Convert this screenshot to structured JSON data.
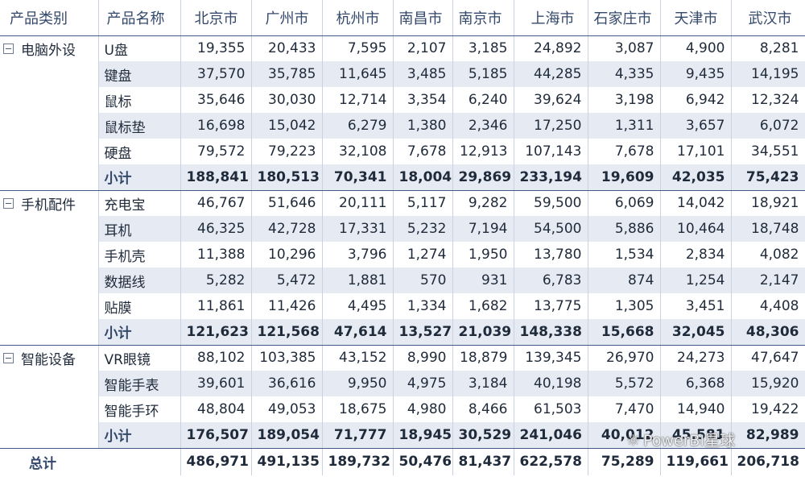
{
  "header": {
    "category": "产品类别",
    "product": "产品名称",
    "cities": [
      "北京市",
      "广州市",
      "杭州市",
      "南昌市",
      "南京市",
      "上海市",
      "石家庄市",
      "天津市",
      "武汉市"
    ]
  },
  "groups": [
    {
      "category": "电脑外设",
      "rows": [
        {
          "name": "U盘",
          "values": [
            "19,355",
            "20,433",
            "7,595",
            "2,107",
            "3,185",
            "24,892",
            "3,087",
            "4,900",
            "8,281"
          ]
        },
        {
          "name": "键盘",
          "values": [
            "37,570",
            "35,785",
            "11,645",
            "3,485",
            "5,185",
            "44,285",
            "4,335",
            "9,435",
            "14,195"
          ]
        },
        {
          "name": "鼠标",
          "values": [
            "35,646",
            "30,030",
            "12,714",
            "3,354",
            "6,240",
            "39,624",
            "3,198",
            "6,942",
            "12,324"
          ]
        },
        {
          "name": "鼠标垫",
          "values": [
            "16,698",
            "15,042",
            "6,279",
            "1,380",
            "2,346",
            "17,250",
            "1,311",
            "3,657",
            "6,072"
          ]
        },
        {
          "name": "硬盘",
          "values": [
            "79,572",
            "79,223",
            "32,108",
            "7,678",
            "12,913",
            "107,143",
            "7,678",
            "17,101",
            "34,551"
          ]
        }
      ],
      "subtotal": {
        "label": "小计",
        "values": [
          "188,841",
          "180,513",
          "70,341",
          "18,004",
          "29,869",
          "233,194",
          "19,609",
          "42,035",
          "75,423"
        ]
      }
    },
    {
      "category": "手机配件",
      "rows": [
        {
          "name": "充电宝",
          "values": [
            "46,767",
            "51,646",
            "20,111",
            "5,117",
            "9,282",
            "59,500",
            "6,069",
            "14,042",
            "18,921"
          ]
        },
        {
          "name": "耳机",
          "values": [
            "46,325",
            "42,728",
            "17,331",
            "5,232",
            "7,194",
            "54,500",
            "5,886",
            "10,464",
            "18,748"
          ]
        },
        {
          "name": "手机壳",
          "values": [
            "11,388",
            "10,296",
            "3,796",
            "1,274",
            "1,950",
            "13,780",
            "1,534",
            "2,834",
            "4,082"
          ]
        },
        {
          "name": "数据线",
          "values": [
            "5,282",
            "5,472",
            "1,881",
            "570",
            "931",
            "6,783",
            "874",
            "1,254",
            "2,147"
          ]
        },
        {
          "name": "贴膜",
          "values": [
            "11,861",
            "11,426",
            "4,495",
            "1,334",
            "1,682",
            "13,775",
            "1,305",
            "3,451",
            "4,408"
          ]
        }
      ],
      "subtotal": {
        "label": "小计",
        "values": [
          "121,623",
          "121,568",
          "47,614",
          "13,527",
          "21,039",
          "148,338",
          "15,668",
          "32,045",
          "48,306"
        ]
      }
    },
    {
      "category": "智能设备",
      "rows": [
        {
          "name": "VR眼镜",
          "values": [
            "88,102",
            "103,385",
            "43,152",
            "8,990",
            "18,879",
            "139,345",
            "26,970",
            "24,273",
            "47,647"
          ]
        },
        {
          "name": "智能手表",
          "values": [
            "39,601",
            "36,616",
            "9,950",
            "4,975",
            "3,184",
            "40,198",
            "5,572",
            "6,368",
            "15,920"
          ]
        },
        {
          "name": "智能手环",
          "values": [
            "48,804",
            "49,053",
            "18,675",
            "4,980",
            "8,466",
            "61,503",
            "7,470",
            "14,940",
            "19,422"
          ]
        }
      ],
      "subtotal": {
        "label": "小计",
        "values": [
          "176,507",
          "189,054",
          "71,777",
          "18,945",
          "30,529",
          "241,046",
          "40,012",
          "45,581",
          "82,989"
        ]
      }
    }
  ],
  "total": {
    "label": "总计",
    "values": [
      "486,971",
      "491,135",
      "189,732",
      "50,476",
      "81,437",
      "622,578",
      "75,289",
      "119,661",
      "206,718"
    ]
  },
  "watermark": {
    "icon": "wechat-icon",
    "text": "PowerBI星球"
  },
  "colors": {
    "accent": "#3f5a86",
    "band": "#e6ebf3",
    "header_text": "#34486b"
  }
}
